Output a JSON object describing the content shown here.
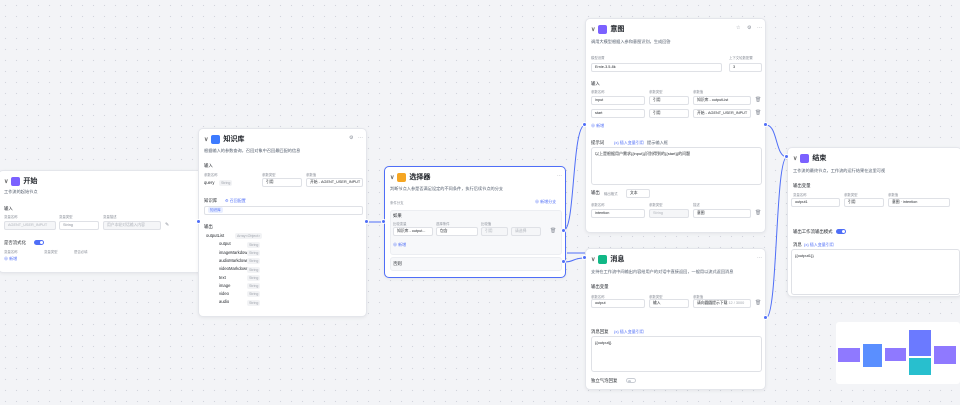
{
  "start": {
    "title": "开始",
    "desc": "工作流的起始节点",
    "input_label": "输入",
    "col_var": "变量名称",
    "col_type": "变量类型",
    "col_desc": "变量描述",
    "row_name": "AGENT_USER_INPUT",
    "row_type": "String",
    "row_desc": "用户本轮对话输入内容",
    "stream_label": "是否流式化",
    "var_cols": [
      "变量名称",
      "变量类型",
      "是否必填"
    ],
    "add": "新增"
  },
  "kb": {
    "title": "知识库",
    "desc": "根据输入的参数查询，召回对象中召回最匹配的信息",
    "input_label": "输入",
    "col_var": "参数名称",
    "col_type": "参数类型",
    "col_val": "参数值",
    "row_name": "query",
    "row_type": "String",
    "row_mode": "引用",
    "row_val": "开始 - AGENT_USER_INPUT",
    "kb_label": "知识库",
    "kb_config": "召回配置",
    "kb_tag": "知识库",
    "output_label": "输出",
    "outputs": [
      [
        "outputList",
        "Array<Object>"
      ],
      [
        "output",
        "String"
      ],
      [
        "imageMarkdown",
        "String"
      ],
      [
        "audioMarkdown",
        "String"
      ],
      [
        "videoMarkdown",
        "String"
      ],
      [
        "text",
        "String"
      ],
      [
        "image",
        "String"
      ],
      [
        "video",
        "String"
      ],
      [
        "audio",
        "String"
      ]
    ]
  },
  "selector": {
    "title": "选择器",
    "desc": "判断节点入参是否满足设定的不同条件，执行后续节点的分支",
    "branch_label": "条件分支",
    "add_branch": "新增分支",
    "if_label": "如果",
    "col_var": "比较变量",
    "col_op": "选择条件",
    "col_cmp": "比较值",
    "var_val": "知识库 - output...",
    "op_val": "包含",
    "mode_val": "引用",
    "cmp_val": "请选择",
    "add": "新增",
    "else_label": "否则"
  },
  "intent": {
    "title": "意图",
    "desc": "调用大模型根据入参和意图识别，生成回答",
    "model_label": "模型设置",
    "context_label": "上下文轮数配置",
    "model_val": "Ernie-3.5-8k",
    "context_val": "3",
    "input_label": "输入",
    "col_name": "参数名称",
    "col_type": "参数类型",
    "col_val": "参数值",
    "rows": [
      [
        "input",
        "引用",
        "知识库 - outputList"
      ],
      [
        "start",
        "引用",
        "开始 - AGENT_USER_INPUT"
      ]
    ],
    "add": "新增",
    "prompt_label": "提示词",
    "prompt_link": "插入变量引用",
    "prompt_hint": "提示输入框",
    "prompt_text": "以上是根据用户需求{{input}}识别得到的{{start}}的问题",
    "output_label": "输出",
    "output_fmt_label": "输出格式",
    "output_fmt": "文本",
    "out_col_name": "参数名称",
    "out_col_type": "参数类型",
    "out_col_desc": "描述",
    "out_name": "intention",
    "out_type": "String",
    "out_desc": "意图"
  },
  "message": {
    "title": "消息",
    "desc": "支持在工作流中间输出内容给用户的对话中直接返回，一般用以流式返回消息",
    "output_var_label": "输出变量",
    "col_name": "参数名称",
    "col_type": "参数类型",
    "col_val": "参数值",
    "row_name": "output",
    "row_type": "输入",
    "row_val": "请向圆圆提示下载",
    "row_count": "12 / 3000",
    "msg_label": "消息回复",
    "msg_link": "插入变量引用",
    "msg_text": "{{output}}",
    "stream_label": "独立气泡回复"
  },
  "end": {
    "title": "结束",
    "desc": "工作流的最终节点，工作流的运行结果在这里可视",
    "output_var_label": "输出变量",
    "col_name": "变量名称",
    "col_type": "参数类型",
    "col_val": "参数值",
    "row_name": "output1",
    "row_mode": "引用",
    "row_val": "意图 · intention",
    "mode_label": "输出工作流输出模式",
    "reply_label": "消息",
    "reply_link": "插入变量引用",
    "reply_text": "{{output1}}"
  },
  "colors": {
    "accent": "#4f6ef7",
    "minimap": [
      "#7b61ff",
      "#3d7bff",
      "#7b61ff",
      "#5b6cff",
      "#11b8c9",
      "#7b61ff"
    ]
  }
}
